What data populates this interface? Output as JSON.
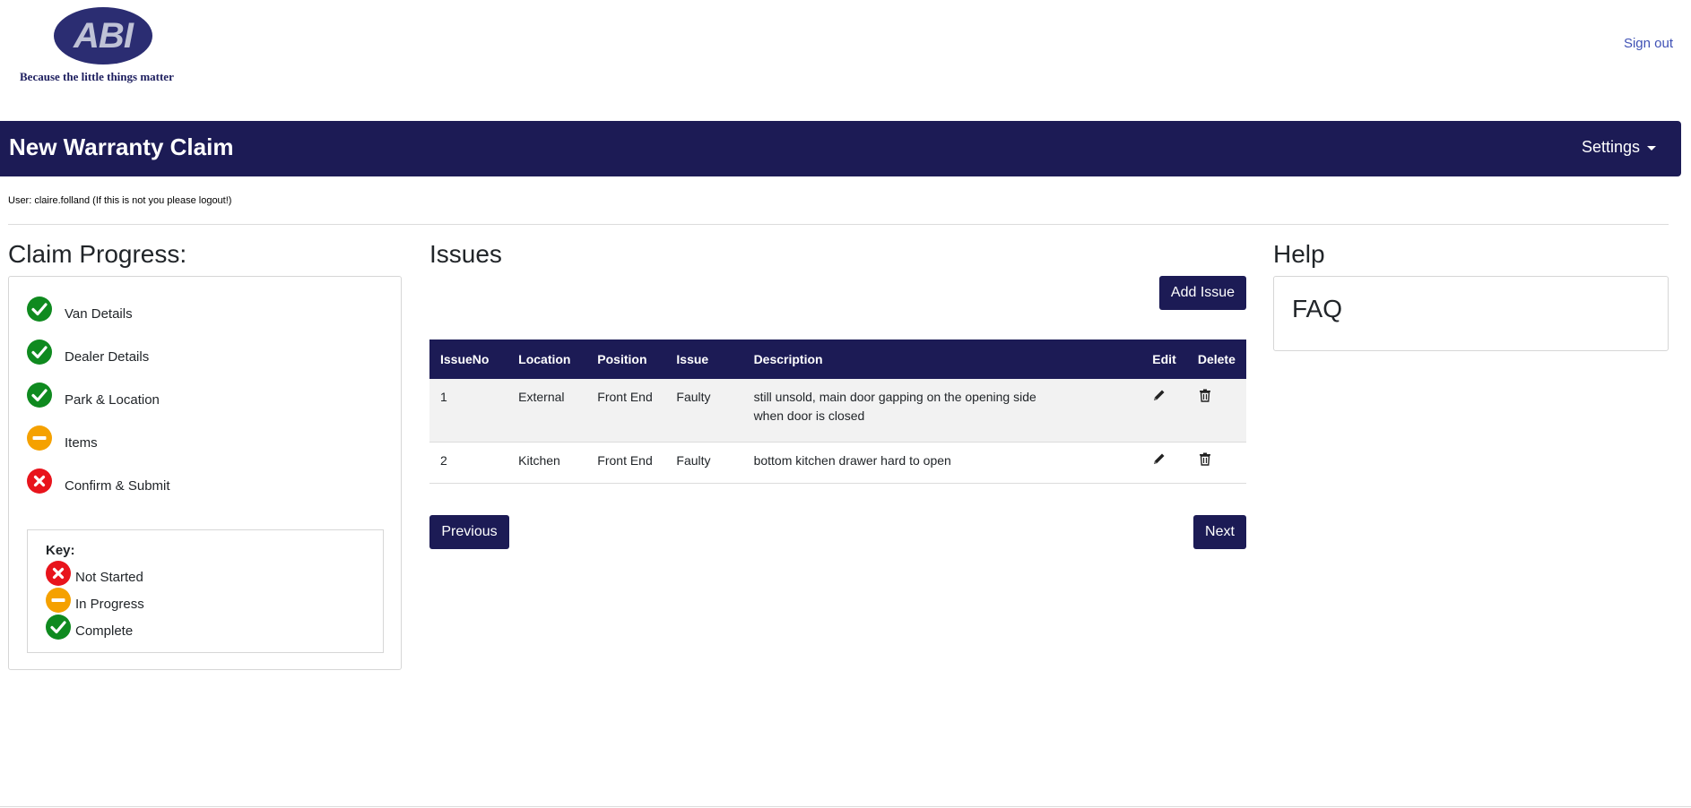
{
  "header": {
    "logo_text": "ABI",
    "tagline": "Because the little things matter",
    "signout_label": "Sign out"
  },
  "titlebar": {
    "title": "New Warranty Claim",
    "settings_label": "Settings"
  },
  "user_line": "User: claire.folland (If this is not you please logout!)",
  "progress": {
    "heading": "Claim Progress:",
    "steps": [
      {
        "label": "Van Details",
        "status": "complete"
      },
      {
        "label": "Dealer Details",
        "status": "complete"
      },
      {
        "label": "Park & Location",
        "status": "complete"
      },
      {
        "label": "Items",
        "status": "in-progress"
      },
      {
        "label": "Confirm & Submit",
        "status": "not-started"
      }
    ],
    "key": {
      "title": "Key:",
      "items": [
        {
          "label": "Not Started",
          "status": "not-started"
        },
        {
          "label": "In Progress",
          "status": "in-progress"
        },
        {
          "label": "Complete",
          "status": "complete"
        }
      ]
    }
  },
  "issues": {
    "heading": "Issues",
    "add_label": "Add Issue",
    "columns": [
      "IssueNo",
      "Location",
      "Position",
      "Issue",
      "Description",
      "Edit",
      "Delete"
    ],
    "rows": [
      {
        "no": "1",
        "location": "External",
        "position": "Front End",
        "issue": "Faulty",
        "description_line1": "still unsold, main door gapping on the opening side",
        "description_line2": "when door is closed"
      },
      {
        "no": "2",
        "location": "Kitchen",
        "position": "Front End",
        "issue": "Faulty",
        "description_line1": "bottom kitchen drawer hard to open",
        "description_line2": ""
      }
    ],
    "previous_label": "Previous",
    "next_label": "Next"
  },
  "help": {
    "heading": "Help",
    "faq_label": "FAQ"
  },
  "colors": {
    "navy": "#1c1b55",
    "complete": "#0f8a1f",
    "in_progress": "#f5a100",
    "not_started": "#e8141c"
  }
}
